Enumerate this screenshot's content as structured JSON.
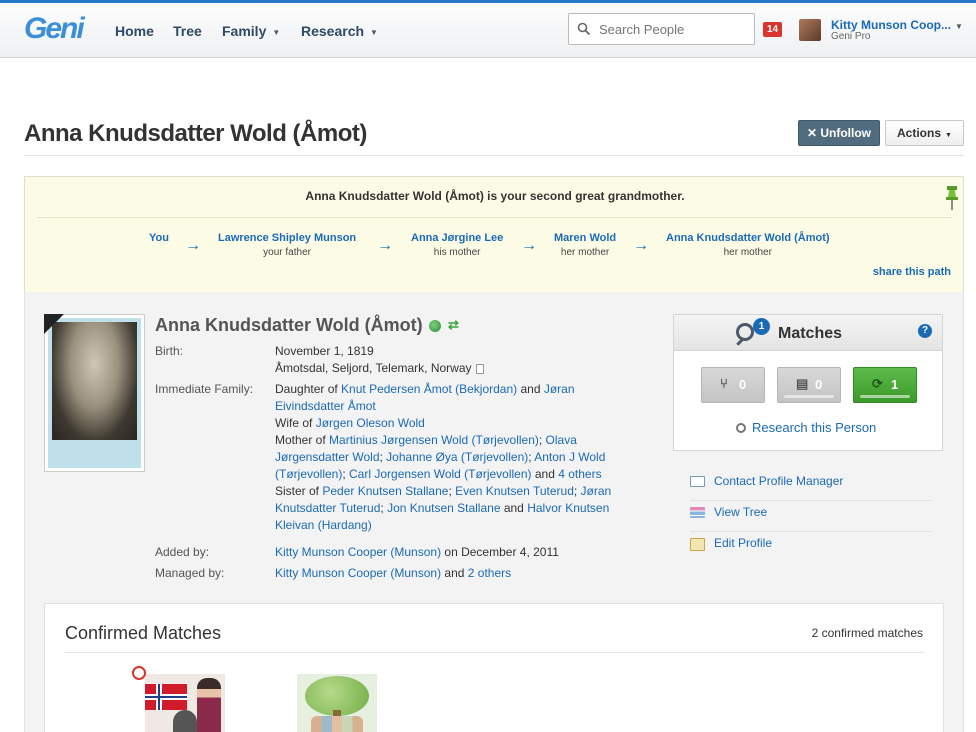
{
  "nav": {
    "logo": "Geni",
    "items": [
      {
        "label": "Home"
      },
      {
        "label": "Tree"
      },
      {
        "label": "Family"
      },
      {
        "label": "Research"
      }
    ],
    "search_placeholder": "Search People",
    "notification_count": "14",
    "user_name": "Kitty Munson Coop...",
    "user_plan": "Geni Pro"
  },
  "profile": {
    "title": "Anna Knudsdatter Wold (Åmot)",
    "unfollow_label": "Unfollow",
    "actions_label": "Actions"
  },
  "relationship": {
    "statement": "Anna Knudsdatter Wold (Åmot) is your second great grandmother.",
    "chain": [
      {
        "name": "You",
        "relation": ""
      },
      {
        "name": "Lawrence Shipley Munson",
        "relation": "your father"
      },
      {
        "name": "Anna Jørgine Lee",
        "relation": "his mother"
      },
      {
        "name": "Maren Wold",
        "relation": "her mother"
      },
      {
        "name": "Anna Knudsdatter Wold (Åmot)",
        "relation": "her mother"
      }
    ],
    "arrow": "→",
    "share_label": "share this path"
  },
  "details": {
    "name": "Anna Knudsdatter Wold (Åmot)",
    "birth_label": "Birth:",
    "birth_date": "November 1, 1819",
    "birth_place": "Åmotsdal, Seljord, Telemark, Norway",
    "family_label": "Immediate Family:",
    "daughter_of_prefix": "Daughter of ",
    "father": "Knut Pedersen Åmot (Bekjordan)",
    "and": " and ",
    "mother": "Jøran Eivindsdatter Åmot",
    "wife_of_prefix": "Wife of ",
    "husband": "Jørgen Oleson Wold",
    "mother_of_prefix": "Mother of ",
    "children": [
      "Martinius Jørgensen Wold (Tørjevollen)",
      "Olava Jørgensdatter Wold",
      "Johanne Øya (Tørjevollen)",
      "Anton J Wold (Tørjevollen)",
      "Carl Jorgensen Wold (Tørjevollen)"
    ],
    "children_more": "4 others",
    "sister_of_prefix": "Sister of ",
    "siblings": [
      "Peder Knutsen Stallane",
      "Even Knutsen Tuterud",
      "Jøran Knutsdatter Tuterud",
      "Jon Knutsen Stallane"
    ],
    "siblings_last": "Halvor Knutsen Kleivan (Hardang)",
    "added_by_label": "Added by:",
    "added_by": "Kitty Munson Cooper (Munson)",
    "added_on": " on December 4, 2011",
    "managed_by_label": "Managed by:",
    "managed_by": "Kitty Munson Cooper (Munson)",
    "managed_more": "2 others"
  },
  "matches": {
    "title": "Matches",
    "badge": "1",
    "help": "?",
    "buttons": [
      {
        "icon": "tree-match-icon",
        "count": "0"
      },
      {
        "icon": "record-match-icon",
        "count": "0"
      },
      {
        "icon": "sync-match-icon",
        "count": "1"
      }
    ],
    "research_label": "Research this Person"
  },
  "side_links": [
    {
      "label": "Contact Profile Manager"
    },
    {
      "label": "View Tree"
    },
    {
      "label": "Edit Profile"
    }
  ],
  "confirmed": {
    "title": "Confirmed Matches",
    "count": "2 confirmed matches"
  },
  "colors": {
    "link": "#1a6ab5",
    "unfollow_bg": "#516c7e",
    "relationship_bg": "#fcfce6",
    "match_green": "#3c9a2c",
    "notification": "#d9342b"
  }
}
